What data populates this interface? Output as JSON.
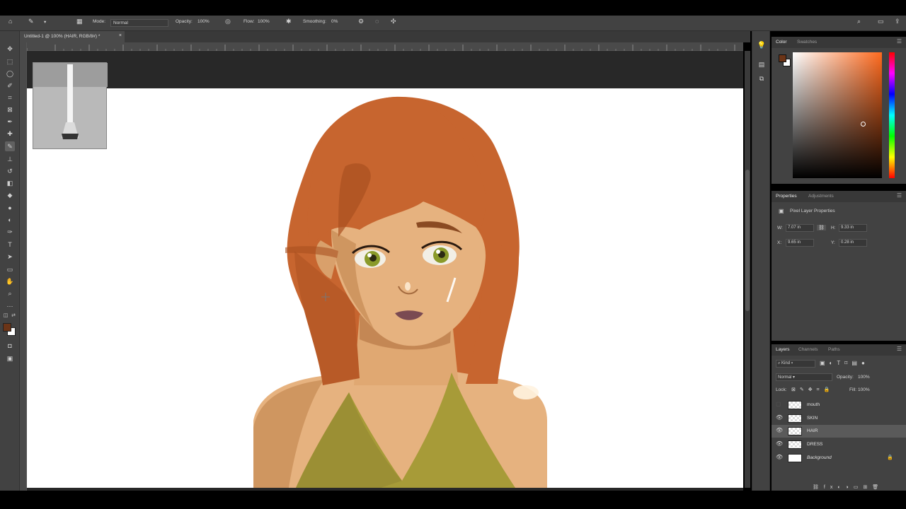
{
  "options_bar": {
    "mode_label": "Mode:",
    "mode_value": "Normal",
    "opacity_label": "Opacity:",
    "opacity_value": "100%",
    "flow_label": "Flow:",
    "flow_value": "100%",
    "smoothing_label": "Smoothing:",
    "smoothing_value": "0%"
  },
  "document_tab": {
    "title": "Untitled-1 @ 100% (HAIR, RGB/8#) *",
    "close": "×"
  },
  "ruler_numbers": [
    "0",
    "1",
    "2",
    "3",
    "4",
    "5",
    "6",
    "7",
    "8",
    "9",
    "10",
    "11",
    "12",
    "13",
    "14",
    "15",
    "16",
    "17",
    "18",
    "19",
    "20"
  ],
  "color_panel": {
    "tabs": [
      "Color",
      "Swatches"
    ],
    "foreground_color": "#6b3417",
    "background_color": "#ffffff",
    "hue_color": "#ff6a1e"
  },
  "properties_panel": {
    "tabs": [
      "Properties",
      "Adjustments"
    ],
    "section_title": "Pixel Layer Properties",
    "w_label": "W:",
    "w_value": "7.07 in",
    "h_label": "H:",
    "h_value": "9.33 in",
    "x_label": "X:",
    "x_value": "9.65 in",
    "y_label": "Y:",
    "y_value": "0.28 in"
  },
  "layers_panel": {
    "tabs": [
      "Layers",
      "Channels",
      "Paths"
    ],
    "filter_kind": "Kind",
    "blend_mode": "Normal",
    "opacity_label": "Opacity:",
    "opacity_value": "100%",
    "lock_label": "Lock:",
    "fill_label": "Fill:",
    "fill_value": "100%",
    "layers": [
      {
        "name": "mouth",
        "visible": false,
        "selected": false
      },
      {
        "name": "SKIN",
        "visible": true,
        "selected": false
      },
      {
        "name": "HAIR",
        "visible": true,
        "selected": true
      },
      {
        "name": "DRESS",
        "visible": true,
        "selected": false
      },
      {
        "name": "Background",
        "visible": true,
        "selected": false,
        "locked": true
      }
    ]
  },
  "colors": {
    "hair": "#c7652f",
    "hair_shadow": "#a9501f",
    "skin": "#e6b27f",
    "skin_shadow": "#c98e59",
    "dress": "#a79b38",
    "lips": "#7a4a52",
    "eyes": "#8a9a2a"
  }
}
